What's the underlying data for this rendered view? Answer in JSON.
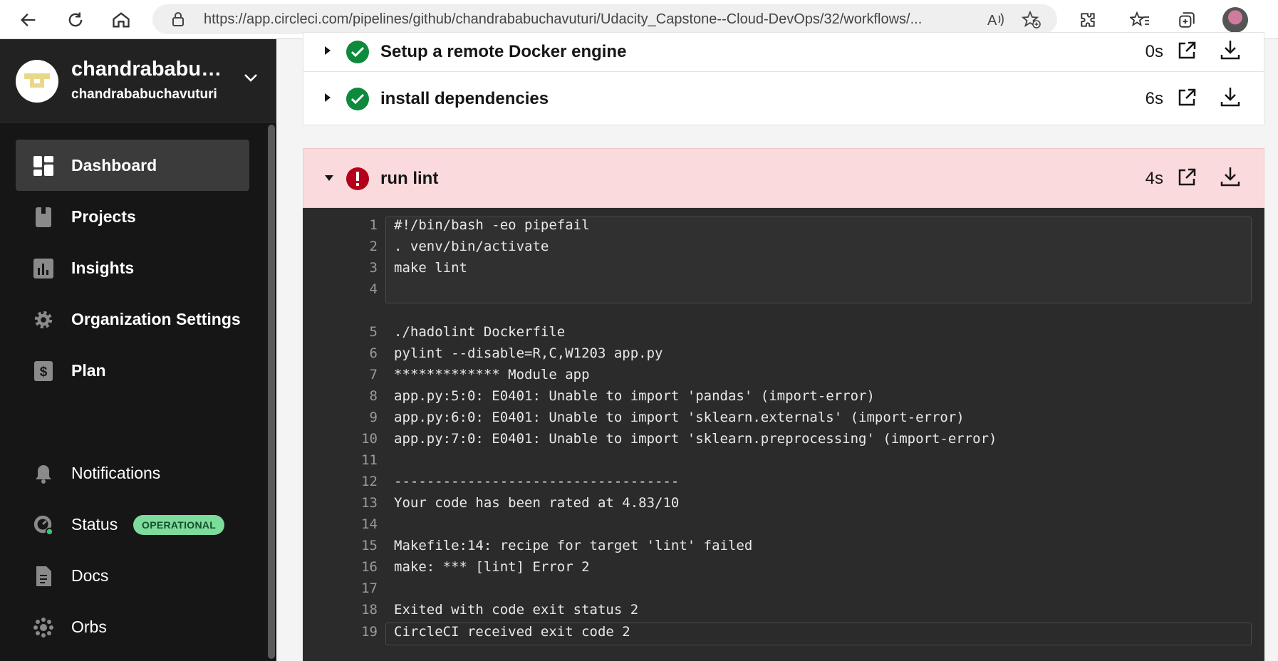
{
  "browser": {
    "url": "https://app.circleci.com/pipelines/github/chandrababuchavuturi/Udacity_Capstone--Cloud-DevOps/32/workflows/..."
  },
  "sidebar": {
    "org_name": "chandrababuchavuturi",
    "org_subtitle": "chandrababuchavuturi",
    "nav_items": [
      {
        "label": "Dashboard",
        "icon": "dashboard-icon",
        "active": true
      },
      {
        "label": "Projects",
        "icon": "projects-icon"
      },
      {
        "label": "Insights",
        "icon": "insights-icon"
      },
      {
        "label": "Organization Settings",
        "icon": "gear-icon"
      },
      {
        "label": "Plan",
        "icon": "dollar-icon"
      }
    ],
    "bottom_items": [
      {
        "label": "Notifications",
        "icon": "bell-icon"
      },
      {
        "label": "Status",
        "icon": "status-gauge-icon",
        "badge": "OPERATIONAL"
      },
      {
        "label": "Docs",
        "icon": "document-icon"
      },
      {
        "label": "Orbs",
        "icon": "orbs-icon"
      }
    ]
  },
  "steps": [
    {
      "name": "Setup a remote Docker engine",
      "duration": "0s",
      "status": "success"
    },
    {
      "name": "install dependencies",
      "duration": "6s",
      "status": "success"
    },
    {
      "name": "run lint",
      "duration": "4s",
      "status": "failed"
    }
  ],
  "terminal": {
    "lines": [
      {
        "n": "1",
        "text": "#!/bin/bash -eo pipefail"
      },
      {
        "n": "2",
        "text": ". venv/bin/activate"
      },
      {
        "n": "3",
        "text": "make lint"
      },
      {
        "n": "4",
        "text": ""
      },
      {
        "n": "5",
        "text": "./hadolint Dockerfile"
      },
      {
        "n": "6",
        "text": "pylint --disable=R,C,W1203 app.py"
      },
      {
        "n": "7",
        "text": "************* Module app"
      },
      {
        "n": "8",
        "text": "app.py:5:0: E0401: Unable to import 'pandas' (import-error)"
      },
      {
        "n": "9",
        "text": "app.py:6:0: E0401: Unable to import 'sklearn.externals' (import-error)"
      },
      {
        "n": "10",
        "text": "app.py:7:0: E0401: Unable to import 'sklearn.preprocessing' (import-error)"
      },
      {
        "n": "11",
        "text": ""
      },
      {
        "n": "12",
        "text": "-----------------------------------"
      },
      {
        "n": "13",
        "text": "Your code has been rated at 4.83/10"
      },
      {
        "n": "14",
        "text": ""
      },
      {
        "n": "15",
        "text": "Makefile:14: recipe for target 'lint' failed"
      },
      {
        "n": "16",
        "text": "make: *** [lint] Error 2"
      },
      {
        "n": "17",
        "text": ""
      },
      {
        "n": "18",
        "text": "Exited with code exit status 2"
      },
      {
        "n": "19",
        "text": "CircleCI received exit code 2"
      }
    ]
  },
  "colors": {
    "success": "#0d8a3c",
    "failed": "#b3001b",
    "failed_row_bg": "#fadadd",
    "status_badge_bg": "#7ddb9c"
  }
}
